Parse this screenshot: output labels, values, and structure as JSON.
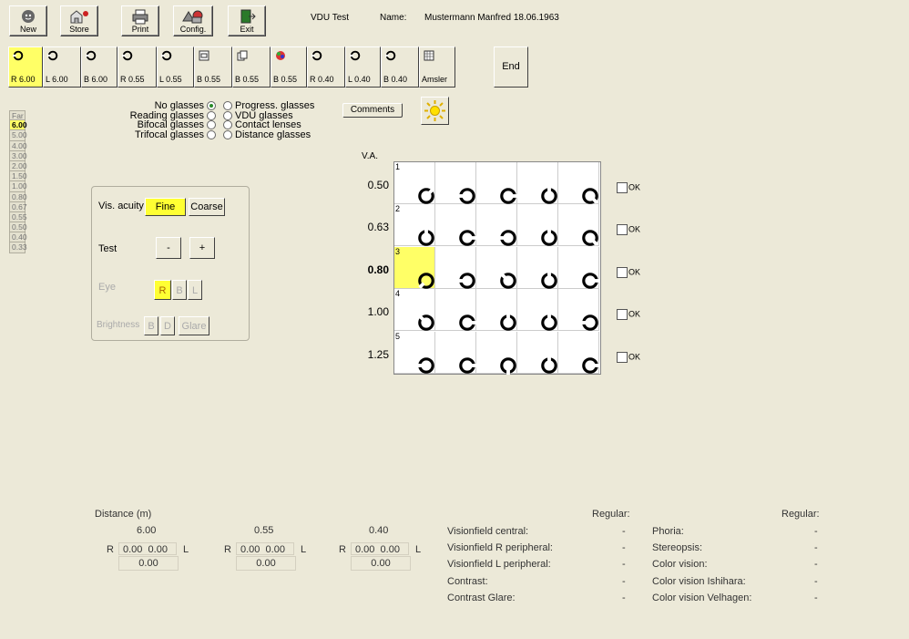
{
  "toolbar": {
    "buttons": [
      {
        "label": "New",
        "icon": "face-icon"
      },
      {
        "label": "Store",
        "icon": "store-icon"
      },
      {
        "label": "Print",
        "icon": "printer-icon"
      },
      {
        "label": "Config.",
        "icon": "config-icon"
      },
      {
        "label": "Exit",
        "icon": "exit-icon"
      }
    ],
    "title": "VDU Test",
    "name_label": "Name:",
    "name_value": "Mustermann Manfred 18.06.1963"
  },
  "test_tabs": [
    {
      "label": "R 6.00",
      "icon": "landolt-ring",
      "active": true
    },
    {
      "label": "L 6.00",
      "icon": "landolt-ring"
    },
    {
      "label": "B 6.00",
      "icon": "landolt-ring"
    },
    {
      "label": "R 0.55",
      "icon": "landolt-ring"
    },
    {
      "label": "L 0.55",
      "icon": "landolt-ring"
    },
    {
      "label": "B 0.55",
      "icon": "square-icon"
    },
    {
      "label": "B 0.55",
      "icon": "copy-icon"
    },
    {
      "label": "B 0.55",
      "icon": "color-icon"
    },
    {
      "label": "R 0.40",
      "icon": "landolt-ring"
    },
    {
      "label": "L 0.40",
      "icon": "landolt-ring"
    },
    {
      "label": "B 0.40",
      "icon": "landolt-ring"
    },
    {
      "label": "Amsler",
      "icon": "grid-icon"
    }
  ],
  "end_label": "End",
  "distance_scale": [
    "Far",
    "6.00",
    "5.00",
    "4.00",
    "3.00",
    "2.00",
    "1.50",
    "1.00",
    "0.80",
    "0.67",
    "0.55",
    "0.50",
    "0.40",
    "0.33"
  ],
  "distance_scale_current": "6.00",
  "glasses_left": [
    "No glasses",
    "Reading glasses",
    "Bifocal glasses",
    "Trifocal glasses"
  ],
  "glasses_right": [
    "Progress. glasses",
    "VDU glasses",
    "Contact lenses",
    "Distance glasses"
  ],
  "glasses_selected": "No glasses",
  "comments_label": "Comments",
  "panel": {
    "vis_acuity_label": "Vis. acuity",
    "fine_label": "Fine",
    "coarse_label": "Coarse",
    "test_label": "Test",
    "minus_label": "-",
    "plus_label": "+",
    "eye_label": "Eye",
    "eye_r": "R",
    "eye_b": "B",
    "eye_l": "L",
    "brightness_label": "Brightness",
    "bright_b": "B",
    "bright_d": "D",
    "glare_label": "Glare"
  },
  "va_header": "V.A.",
  "va_rows": [
    {
      "num": "1",
      "va": "0.50",
      "rotations": [
        315,
        180,
        0,
        270,
        45
      ],
      "ok": "OK"
    },
    {
      "num": "2",
      "va": "0.63",
      "rotations": [
        270,
        0,
        180,
        270,
        45
      ],
      "ok": "OK"
    },
    {
      "num": "3",
      "va": "0.80",
      "rotations": [
        135,
        180,
        225,
        270,
        0
      ],
      "ok": "OK",
      "current": true
    },
    {
      "num": "4",
      "va": "1.00",
      "rotations": [
        225,
        0,
        270,
        270,
        180
      ],
      "ok": "OK"
    },
    {
      "num": "5",
      "va": "1.25",
      "rotations": [
        180,
        0,
        90,
        270,
        0
      ],
      "ok": "OK"
    }
  ],
  "bottom": {
    "distance_header": "Distance (m)",
    "distances": [
      {
        "dist": "6.00",
        "r": "R",
        "val_r": "0.00",
        "val_l": "0.00",
        "l": "L",
        "binoc": "0.00"
      },
      {
        "dist": "0.55",
        "r": "R",
        "val_r": "0.00",
        "val_l": "0.00",
        "l": "L",
        "binoc": "0.00"
      },
      {
        "dist": "0.40",
        "r": "R",
        "val_r": "0.00",
        "val_l": "0.00",
        "l": "L",
        "binoc": "0.00"
      }
    ],
    "regular_label": "Regular:",
    "left_results": [
      {
        "label": "Visionfield central:",
        "value": "-"
      },
      {
        "label": "Visionfield R peripheral:",
        "value": "-"
      },
      {
        "label": "Visionfield L peripheral:",
        "value": "-"
      },
      {
        "label": "Contrast:",
        "value": "-"
      },
      {
        "label": "Contrast Glare:",
        "value": "-"
      }
    ],
    "right_results": [
      {
        "label": "Phoria:",
        "value": "-"
      },
      {
        "label": "Stereopsis:",
        "value": "-"
      },
      {
        "label": "Color vision:",
        "value": "-"
      },
      {
        "label": "Color vision Ishihara:",
        "value": "-"
      },
      {
        "label": "Color vision Velhagen:",
        "value": "-"
      }
    ]
  },
  "colors": {
    "highlight": "#ffff66",
    "background": "#ece9d8"
  }
}
